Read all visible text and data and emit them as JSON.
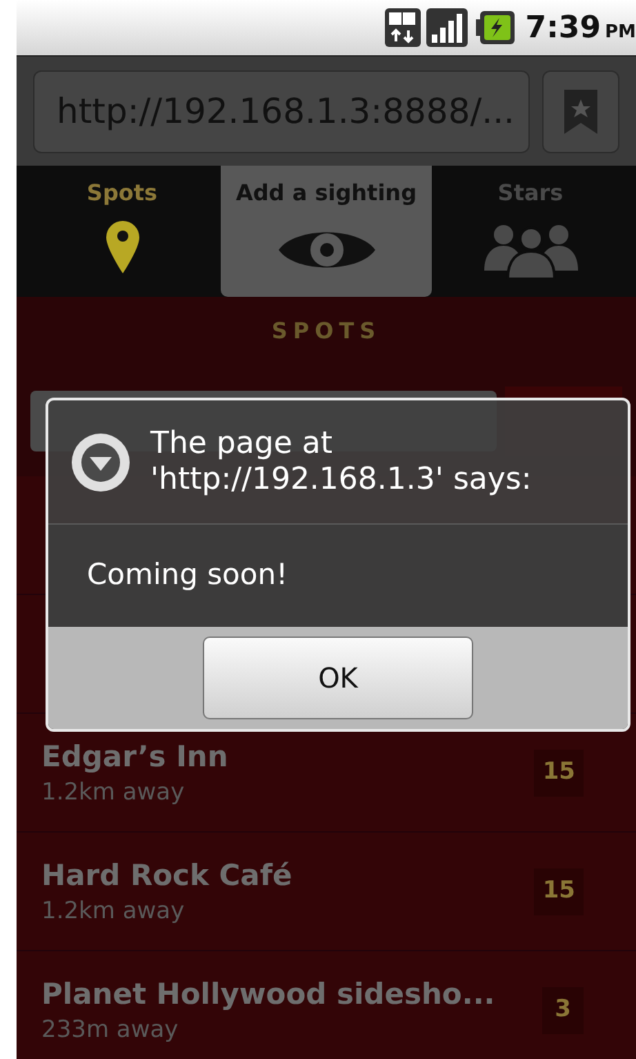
{
  "status_bar": {
    "time": "7:39",
    "time_suffix": "PM"
  },
  "browser": {
    "url": "http://192.168.1.3:8888/..."
  },
  "tabs": [
    {
      "label": "Spots",
      "kind": "pin",
      "selected": false,
      "current": true
    },
    {
      "label": "Add a sighting",
      "kind": "eye",
      "selected": true,
      "current": false
    },
    {
      "label": "Stars",
      "kind": "people",
      "selected": false,
      "current": false
    }
  ],
  "section_title": "SPOTS",
  "spots": [
    {
      "name": "Edgar’s Inn",
      "distance": "1.2km away",
      "count": "15"
    },
    {
      "name": "Hard Rock Café",
      "distance": "1.2km away",
      "count": "15"
    },
    {
      "name": "Planet Hollywood sidesho...",
      "distance": "233m away",
      "count": "3"
    }
  ],
  "dialog": {
    "title": "The page at 'http://192.168.1.3' says:",
    "message": "Coming soon!",
    "button": "OK"
  }
}
